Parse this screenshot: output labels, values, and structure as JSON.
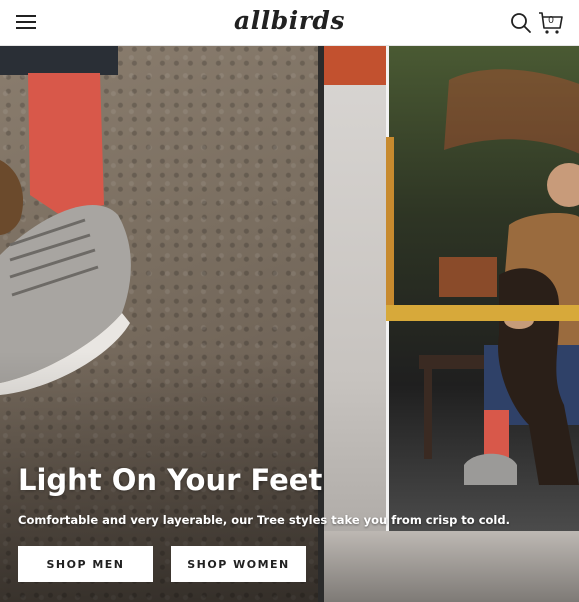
{
  "header": {
    "logo_text": "allbirds",
    "cart_count": "0",
    "icons": {
      "menu": "hamburger-menu-icon",
      "search": "search-icon",
      "cart": "cart-icon"
    }
  },
  "hero": {
    "title": "Light On Your Feet",
    "subtitle": "Comfortable and very layerable, our Tree styles take you from crisp to cold.",
    "buttons": {
      "shop_men": "SHOP MEN",
      "shop_women": "SHOP WOMEN"
    }
  },
  "colors": {
    "text_dark": "#212121",
    "button_bg": "#ffffff",
    "hero_text": "#ffffff"
  }
}
